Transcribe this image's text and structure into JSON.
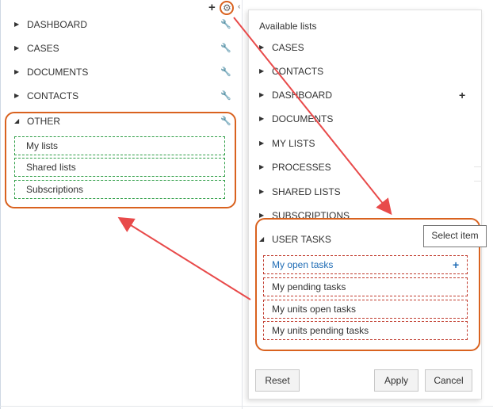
{
  "toolbar": {
    "plus_glyph": "+",
    "gear_glyph": "⚙",
    "collapse_glyph": "‹"
  },
  "nav": {
    "items": [
      {
        "label": "DASHBOARD"
      },
      {
        "label": "CASES"
      },
      {
        "label": "DOCUMENTS"
      },
      {
        "label": "CONTACTS"
      }
    ],
    "other": {
      "label": "OTHER",
      "sublists": [
        {
          "label": "My lists"
        },
        {
          "label": "Shared lists"
        },
        {
          "label": "Subscriptions"
        }
      ]
    },
    "wrench_glyph": "🔧"
  },
  "panel": {
    "title": "Available lists",
    "lists": [
      {
        "label": "CASES"
      },
      {
        "label": "CONTACTS"
      },
      {
        "label": "DASHBOARD"
      },
      {
        "label": "DOCUMENTS"
      },
      {
        "label": "MY LISTS"
      },
      {
        "label": "PROCESSES"
      },
      {
        "label": "SHARED LISTS"
      },
      {
        "label": "SUBSCRIPTIONS"
      }
    ],
    "user_tasks": {
      "label": "USER TASKS",
      "tooltip": "Select item",
      "tasks": [
        {
          "label": "My open tasks"
        },
        {
          "label": "My pending tasks"
        },
        {
          "label": "My units open tasks"
        },
        {
          "label": "My units pending tasks"
        }
      ]
    },
    "buttons": {
      "reset": "Reset",
      "apply": "Apply",
      "cancel": "Cancel"
    }
  },
  "colors": {
    "highlight": "#d9621f",
    "arrow": "#e84a4a",
    "link": "#1f6cb5",
    "dashed_green": "#2e9e46",
    "dashed_red": "#c0392b"
  }
}
